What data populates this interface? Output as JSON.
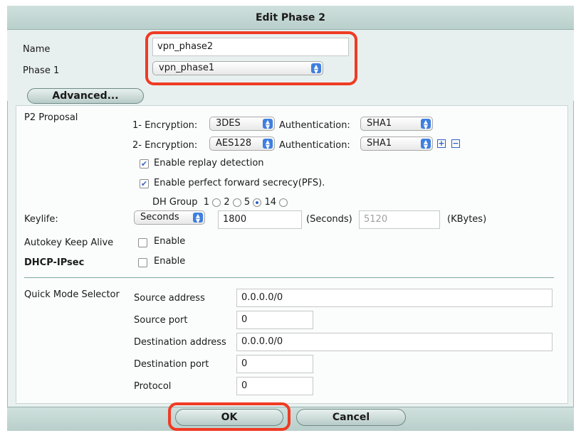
{
  "title": "Edit Phase 2",
  "name": {
    "label": "Name",
    "value": "vpn_phase2"
  },
  "phase1": {
    "label": "Phase 1",
    "value": "vpn_phase1"
  },
  "advanced_label": "Advanced...",
  "p2_proposal": {
    "label": "P2 Proposal",
    "rows": [
      {
        "prefix": "1- Encryption:",
        "encryption": "3DES",
        "auth_label": "Authentication:",
        "auth": "SHA1"
      },
      {
        "prefix": "2- Encryption:",
        "encryption": "AES128",
        "auth_label": "Authentication:",
        "auth": "SHA1"
      }
    ],
    "add_symbol": "+",
    "remove_symbol": "−",
    "replay": {
      "label": "Enable replay detection",
      "checked": true
    },
    "pfs": {
      "label": "Enable perfect forward secrecy(PFS).",
      "checked": true
    },
    "dh_group": {
      "label": "DH Group",
      "options": [
        "1",
        "2",
        "5",
        "14"
      ],
      "selected": "5"
    }
  },
  "keylife": {
    "label": "Keylife:",
    "unit": "Seconds",
    "seconds_value": "1800",
    "seconds_label": "(Seconds)",
    "kbytes_value": "5120",
    "kbytes_label": "(KBytes)"
  },
  "autokey": {
    "label": "Autokey Keep Alive",
    "option": "Enable",
    "checked": false
  },
  "dhcp": {
    "label": "DHCP-IPsec",
    "option": "Enable",
    "checked": false
  },
  "quick_mode": {
    "label": "Quick Mode Selector",
    "source_address": {
      "label": "Source address",
      "value": "0.0.0.0/0"
    },
    "source_port": {
      "label": "Source port",
      "value": "0"
    },
    "dest_address": {
      "label": "Destination address",
      "value": "0.0.0.0/0"
    },
    "dest_port": {
      "label": "Destination port",
      "value": "0"
    },
    "protocol": {
      "label": "Protocol",
      "value": "0"
    }
  },
  "buttons": {
    "ok": "OK",
    "cancel": "Cancel"
  },
  "colors": {
    "header": "#c5d8d5",
    "panel": "#e8f0ef",
    "callout": "#ef3b24",
    "accent": "#3f7fe0"
  }
}
